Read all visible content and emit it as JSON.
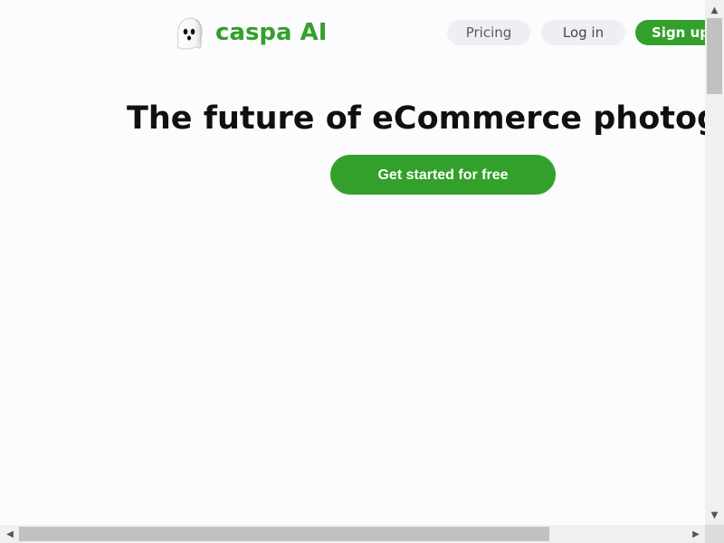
{
  "brand": {
    "name": "caspa AI",
    "logo_icon": "ghost-icon",
    "accent_color": "#33a02c"
  },
  "nav": {
    "pricing": "Pricing",
    "login": "Log in",
    "signup": "Sign up"
  },
  "hero": {
    "title": "The future of eCommerce photography",
    "cta": "Get started for free"
  },
  "scrollbars": {
    "up_icon": "▲",
    "down_icon": "▼",
    "left_icon": "◀",
    "right_icon": "▶"
  }
}
